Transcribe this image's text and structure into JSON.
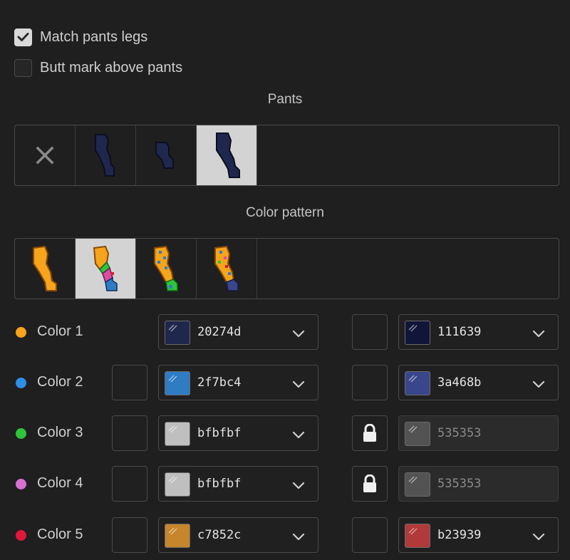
{
  "options": {
    "match_legs": {
      "label": "Match pants legs",
      "checked": true
    },
    "butt_mark": {
      "label": "Butt mark above pants",
      "checked": false
    }
  },
  "pants": {
    "title": "Pants",
    "items": [
      {
        "name": "none",
        "icon": "x-icon"
      },
      {
        "name": "pants-1",
        "icon": "pants-leg-icon"
      },
      {
        "name": "pants-2",
        "icon": "pants-short-icon"
      },
      {
        "name": "pants-3",
        "icon": "pants-leg-icon",
        "selected": true
      }
    ]
  },
  "pattern": {
    "title": "Color pattern",
    "items": [
      {
        "name": "pattern-1",
        "icon": "plain-leg-icon"
      },
      {
        "name": "pattern-2",
        "icon": "striped-leg-icon",
        "selected": true
      },
      {
        "name": "pattern-3",
        "icon": "dotted-leg-icon"
      },
      {
        "name": "pattern-4",
        "icon": "multicolor-leg-icon"
      }
    ]
  },
  "colors": [
    {
      "label": "Color 1",
      "dot": "#f5a41c",
      "has_left_box": false,
      "primary": {
        "hex": "20274d",
        "swatch": "#20274d"
      },
      "right_box": "empty",
      "secondary": {
        "hex": "111639",
        "swatch": "#111639",
        "disabled": false
      }
    },
    {
      "label": "Color 2",
      "dot": "#2f8ee8",
      "has_left_box": true,
      "primary": {
        "hex": "2f7bc4",
        "swatch": "#2f7bc4"
      },
      "right_box": "empty",
      "secondary": {
        "hex": "3a468b",
        "swatch": "#3a468b",
        "disabled": false
      }
    },
    {
      "label": "Color 3",
      "dot": "#2ec53a",
      "has_left_box": true,
      "primary": {
        "hex": "bfbfbf",
        "swatch": "#bfbfbf"
      },
      "right_box": "lock-icon",
      "secondary": {
        "hex": "535353",
        "swatch": "#535353",
        "disabled": true
      }
    },
    {
      "label": "Color 4",
      "dot": "#d96fd1",
      "has_left_box": true,
      "primary": {
        "hex": "bfbfbf",
        "swatch": "#bfbfbf"
      },
      "right_box": "lock-icon",
      "secondary": {
        "hex": "535353",
        "swatch": "#535353",
        "disabled": true
      }
    },
    {
      "label": "Color 5",
      "dot": "#e0163a",
      "has_left_box": true,
      "primary": {
        "hex": "c7852c",
        "swatch": "#c7852c"
      },
      "right_box": "empty",
      "secondary": {
        "hex": "b23939",
        "swatch": "#b23939",
        "disabled": false
      }
    }
  ]
}
